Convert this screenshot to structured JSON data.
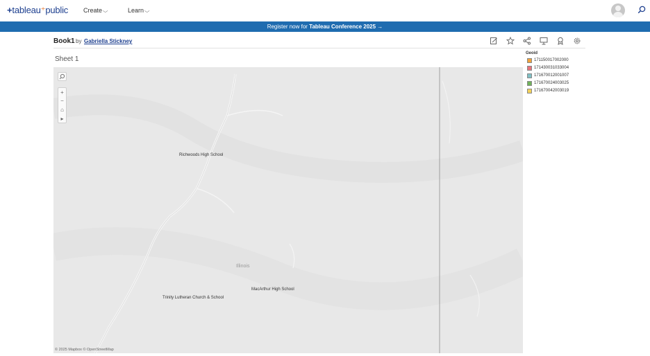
{
  "nav": {
    "logo_prefix": "+",
    "logo_text": "tableau",
    "logo_suffix": "public",
    "create_label": "Create",
    "learn_label": "Learn",
    "chevron": "⌵"
  },
  "banner": {
    "text": "Register now for",
    "highlight": "Tableau Conference 2025 →",
    "color": "#1f6cb0"
  },
  "workbook": {
    "title": "Book1",
    "by": "by",
    "author": "Gabriella Stickney",
    "toolbar_icons": [
      "edit-icon",
      "star-icon",
      "share-icon",
      "download-icon",
      "favorite-icon",
      "settings-icon"
    ]
  },
  "sheet": {
    "title": "Sheet 1"
  },
  "map": {
    "state_label": "Illinois",
    "places": [
      {
        "name": "Richwoods High School"
      },
      {
        "name": "MacArthur High School"
      },
      {
        "name": "Trinity Lutheran Church & School"
      }
    ],
    "attribution": "© 2025 Mapbox  © OpenStreetMap",
    "controls": [
      "search-icon",
      "zoom-in-icon",
      "zoom-out-icon",
      "home-icon",
      "pan-arrow-icon"
    ]
  },
  "legend": {
    "title": "Geoid",
    "items": [
      {
        "label": "171150017002000",
        "color": "#f2a33a"
      },
      {
        "label": "171430031033004",
        "color": "#e8737a"
      },
      {
        "label": "171670012001007",
        "color": "#7fbfc4"
      },
      {
        "label": "171670024003025",
        "color": "#6fb35a"
      },
      {
        "label": "171670042003019",
        "color": "#f2d15a"
      }
    ]
  }
}
